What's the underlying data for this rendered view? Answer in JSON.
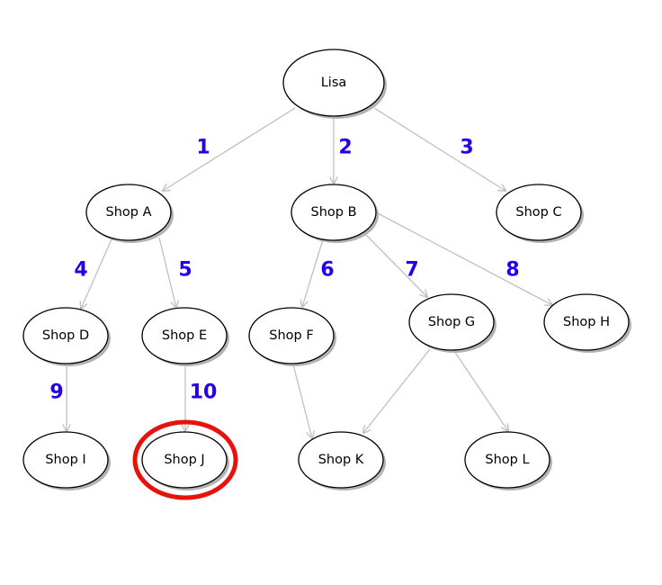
{
  "diagram": {
    "type": "tree",
    "colors": {
      "edge": "#c0c0c0",
      "edge_label": "#2200ee",
      "highlight": "#e8120c"
    },
    "nodes": [
      {
        "id": "lisa",
        "label": "Lisa"
      },
      {
        "id": "a",
        "label": "Shop A"
      },
      {
        "id": "b",
        "label": "Shop B"
      },
      {
        "id": "c",
        "label": "Shop C"
      },
      {
        "id": "d",
        "label": "Shop D"
      },
      {
        "id": "e",
        "label": "Shop E"
      },
      {
        "id": "f",
        "label": "Shop F"
      },
      {
        "id": "g",
        "label": "Shop G"
      },
      {
        "id": "h",
        "label": "Shop H"
      },
      {
        "id": "i",
        "label": "Shop I"
      },
      {
        "id": "j",
        "label": "Shop J",
        "highlighted": true
      },
      {
        "id": "k",
        "label": "Shop K"
      },
      {
        "id": "l",
        "label": "Shop L"
      }
    ],
    "edges": [
      {
        "from": "lisa",
        "to": "a",
        "label": "1"
      },
      {
        "from": "lisa",
        "to": "b",
        "label": "2"
      },
      {
        "from": "lisa",
        "to": "c",
        "label": "3"
      },
      {
        "from": "a",
        "to": "d",
        "label": "4"
      },
      {
        "from": "a",
        "to": "e",
        "label": "5"
      },
      {
        "from": "b",
        "to": "f",
        "label": "6"
      },
      {
        "from": "b",
        "to": "g",
        "label": "7"
      },
      {
        "from": "b",
        "to": "h",
        "label": "8"
      },
      {
        "from": "d",
        "to": "i",
        "label": "9"
      },
      {
        "from": "e",
        "to": "j",
        "label": "10"
      },
      {
        "from": "f",
        "to": "k",
        "label": ""
      },
      {
        "from": "g",
        "to": "k",
        "label": ""
      },
      {
        "from": "g",
        "to": "l",
        "label": ""
      }
    ]
  }
}
